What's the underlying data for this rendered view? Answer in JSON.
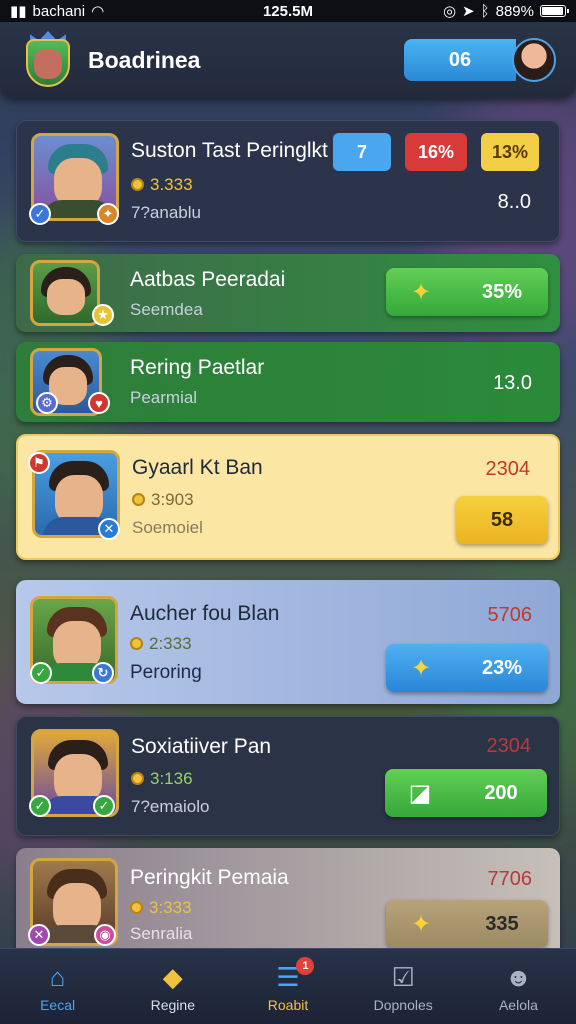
{
  "status_bar": {
    "carrier": "bachani",
    "time": "125.5M",
    "battery": "889%",
    "battery_level": 0.89
  },
  "header": {
    "title": "Boadrinea",
    "score": "06"
  },
  "rows": [
    {
      "name": "Suston Tast Peringlkt",
      "coins": "3.333",
      "subtitle": "7?anablu",
      "chip1": "7",
      "chip2": "16%",
      "chip3": "13%",
      "value": "8..0"
    },
    {
      "name": "Aatbas Peeradai",
      "subtitle": "Seemdea",
      "button": "35%"
    },
    {
      "name": "Rering Paetlar",
      "subtitle": "Pearmial",
      "value": "13.0"
    },
    {
      "name": "Gyaarl Kt Ban",
      "coins": "3:903",
      "subtitle": "Soemoiel",
      "value": "2304",
      "button": "58"
    },
    {
      "name": "Aucher fou Blan",
      "coins": "2:333",
      "subtitle": "Peroring",
      "value": "5706",
      "button": "23%"
    },
    {
      "name": "Soxiatiiver Pan",
      "coins": "3:136",
      "subtitle": "7?emaiolo",
      "value": "2304",
      "button": "200"
    },
    {
      "name": "Peringkit Pemaia",
      "coins": "3:333",
      "subtitle": "Senralia",
      "value": "7706",
      "button": "335"
    }
  ],
  "nav": [
    {
      "label": "Eecal",
      "icon": "home-icon"
    },
    {
      "label": "Regine",
      "icon": "cat-icon"
    },
    {
      "label": "Roabit",
      "icon": "list-icon",
      "notifications": "1"
    },
    {
      "label": "Dopnoles",
      "icon": "check-icon"
    },
    {
      "label": "Aelola",
      "icon": "profile-icon"
    }
  ],
  "colors": {
    "green": "#2f8f3f",
    "yellow": "#fbe6a4",
    "blue": "#8fa8d6",
    "accent": "#2b8ad6"
  }
}
